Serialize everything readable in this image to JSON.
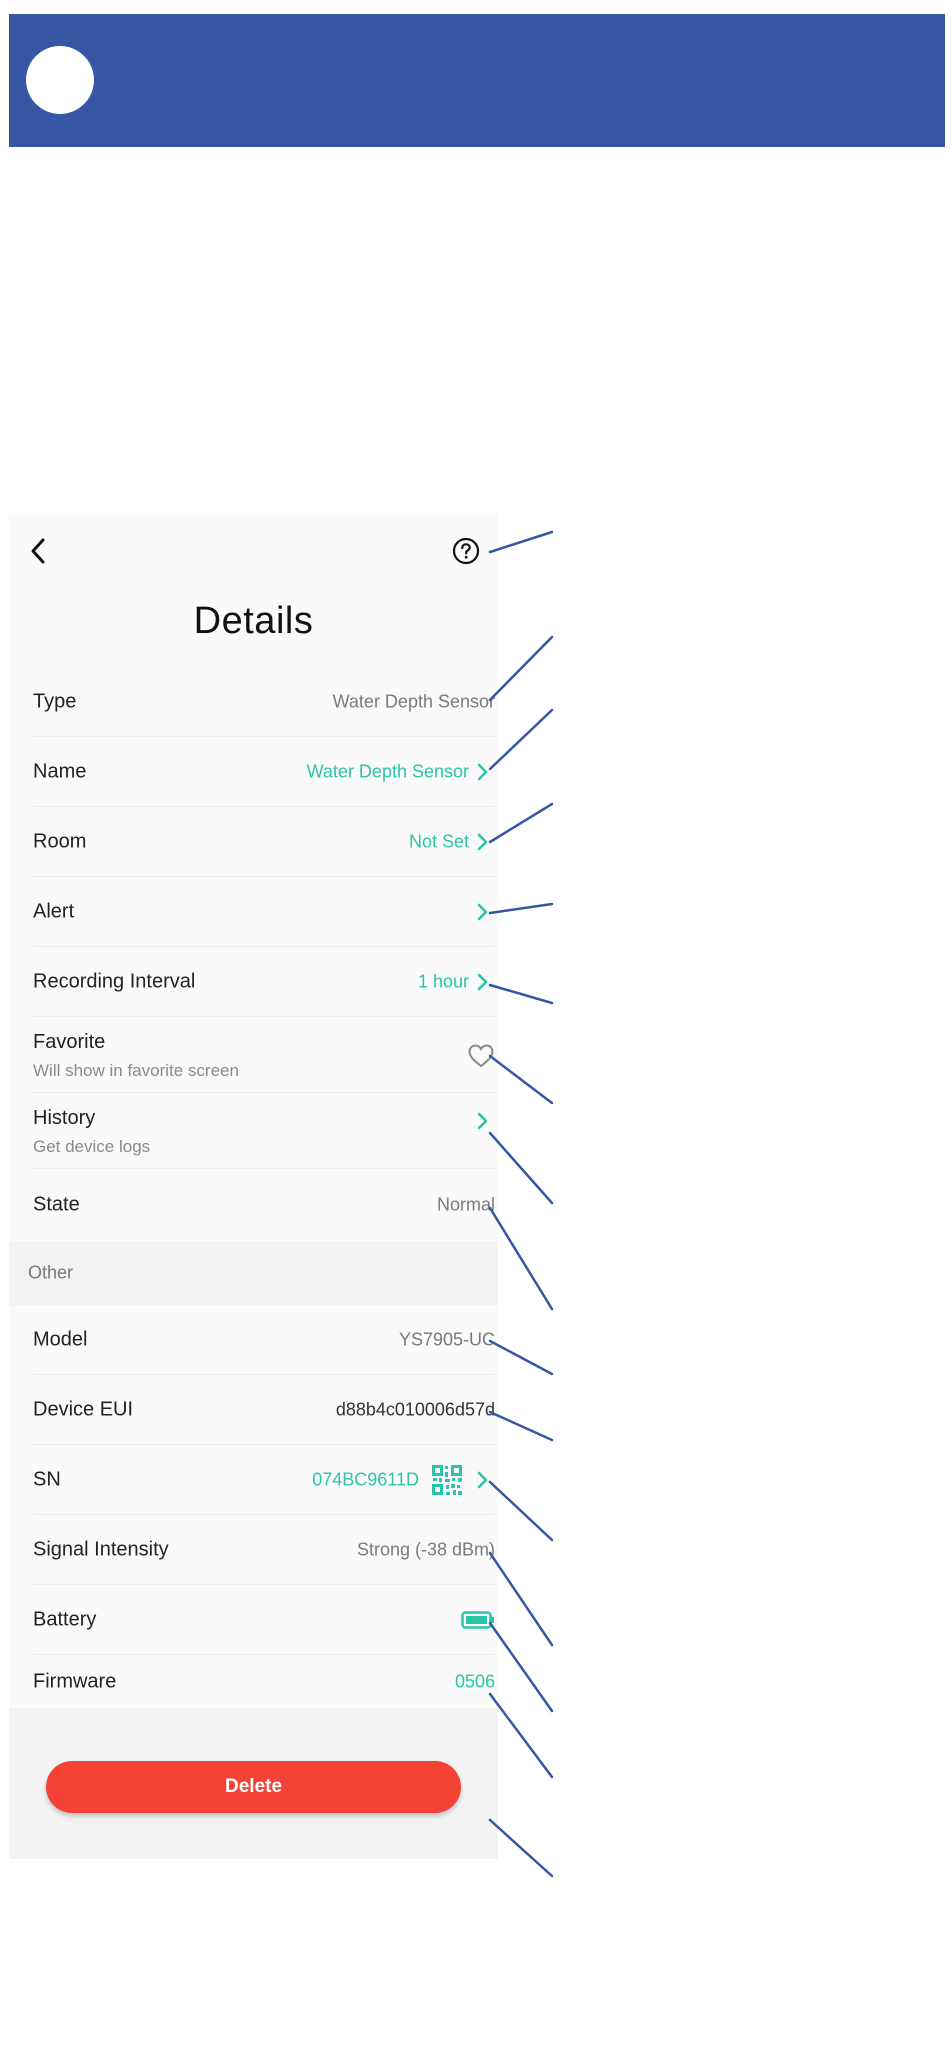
{
  "screen": {
    "title": "Details",
    "rows": [
      {
        "label": "Type",
        "value": "Water Depth Sensor"
      },
      {
        "label": "Name",
        "value": "Water Depth Sensor"
      },
      {
        "label": "Room",
        "value": "Not Set"
      },
      {
        "label": "Alert",
        "value": ""
      },
      {
        "label": "Recording Interval",
        "value": "1 hour"
      },
      {
        "label": "Favorite",
        "sub": "Will show in favorite screen"
      },
      {
        "label": "History",
        "sub": "Get device logs"
      },
      {
        "label": "State",
        "value": "Normal"
      }
    ],
    "section_other": "Other",
    "other_rows": [
      {
        "label": "Model",
        "value": "YS7905-UC"
      },
      {
        "label": "Device EUI",
        "value": "d88b4c010006d57d"
      },
      {
        "label": "SN",
        "value": "074BC9611D"
      },
      {
        "label": "Signal Intensity",
        "value": "Strong (-38 dBm)"
      },
      {
        "label": "Battery",
        "value": ""
      },
      {
        "label": "Firmware",
        "value": "0506"
      }
    ],
    "delete_label": "Delete"
  },
  "icons": {
    "back": "chevron-left-icon",
    "help": "question-circle-icon",
    "arrow": "chevron-right-icon",
    "favorite": "heart-outline-icon",
    "qr": "qr-code-icon",
    "battery": "battery-icon"
  },
  "colors": {
    "header": "#3757a5",
    "accent": "#2cc4a8",
    "danger": "#f44336",
    "callout": "#3757a5"
  }
}
